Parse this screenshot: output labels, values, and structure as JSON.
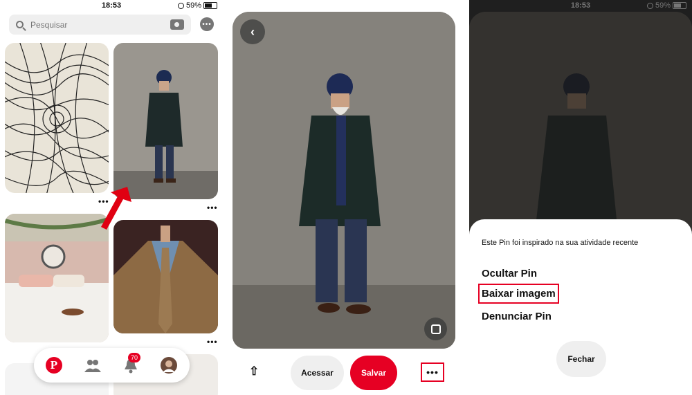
{
  "status_bar": {
    "time": "18:53",
    "battery": "59%"
  },
  "feed": {
    "search_placeholder": "Pesquisar",
    "tile_menu": "•••",
    "notifications_badge": "70"
  },
  "pin_detail": {
    "back_glyph": "‹",
    "share_glyph": "⇧",
    "visit_label": "Acessar",
    "save_label": "Salvar",
    "more_glyph": "•••"
  },
  "options_sheet": {
    "hint": "Este Pin foi inspirado na sua atividade recente",
    "items": [
      "Ocultar Pin",
      "Baixar imagem",
      "Denunciar Pin"
    ],
    "close_label": "Fechar"
  },
  "colors": {
    "brand": "#e60023",
    "highlight": "#e60023"
  },
  "icons": [
    "search-icon",
    "camera-icon",
    "chat-icon",
    "home-icon",
    "people-icon",
    "bell-icon",
    "back-icon",
    "share-icon",
    "visual-search-icon",
    "more-icon"
  ]
}
